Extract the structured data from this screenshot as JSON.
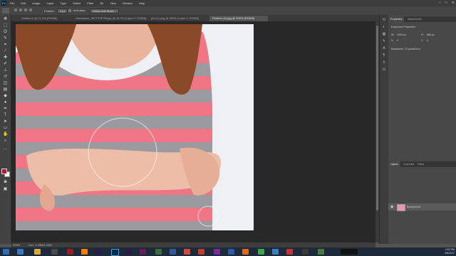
{
  "app": {
    "logo": "Ps"
  },
  "menu": [
    "File",
    "Edit",
    "Image",
    "Layer",
    "Type",
    "Select",
    "Filter",
    "3D",
    "View",
    "Window",
    "Help"
  ],
  "options": {
    "feather_label": "Feather:",
    "feather_value": "0 px",
    "antialias_label": "Anti-alias",
    "select_mask_button": "Select and Mask..."
  },
  "tabs": [
    {
      "label": "Untitled-1 @ 21.3% (RGB/8)"
    },
    {
      "label": "Handsome_INCTX9P7M.jpg @ 16.7% (Layer 0, RGB/8)"
    },
    {
      "label": "pbl-(1).png @ 300% (Layer 0, RGB/8)"
    },
    {
      "label": "Рeнetто (1).jpg @ 200% (RGB/8)"
    }
  ],
  "status": {
    "zoom": "200%",
    "doc": "Doc: 1.03M/1.03M"
  },
  "panel": {
    "tabs": [
      "Properties",
      "Adjustments"
    ],
    "doc_props": "Document Properties",
    "w_label": "W:",
    "w_value": "1300 px",
    "h_label": "H:",
    "h_value": "866 px",
    "x_label": "X:",
    "x_value": "0",
    "y_label": "Y:",
    "y_value": "0",
    "resolution": "Resolution: 72 pixels/inch"
  },
  "layers": {
    "tabs": [
      "Layers",
      "Channels",
      "Paths"
    ],
    "layer_name": "Background"
  },
  "tray": {
    "time": "4:52 PM",
    "date": "3/8/2017"
  },
  "colors": {
    "accent": "#31a8ff",
    "foreground": "#c0152b",
    "stripe_pink": "#f07585",
    "stripe_gray": "#9a9a9f"
  }
}
